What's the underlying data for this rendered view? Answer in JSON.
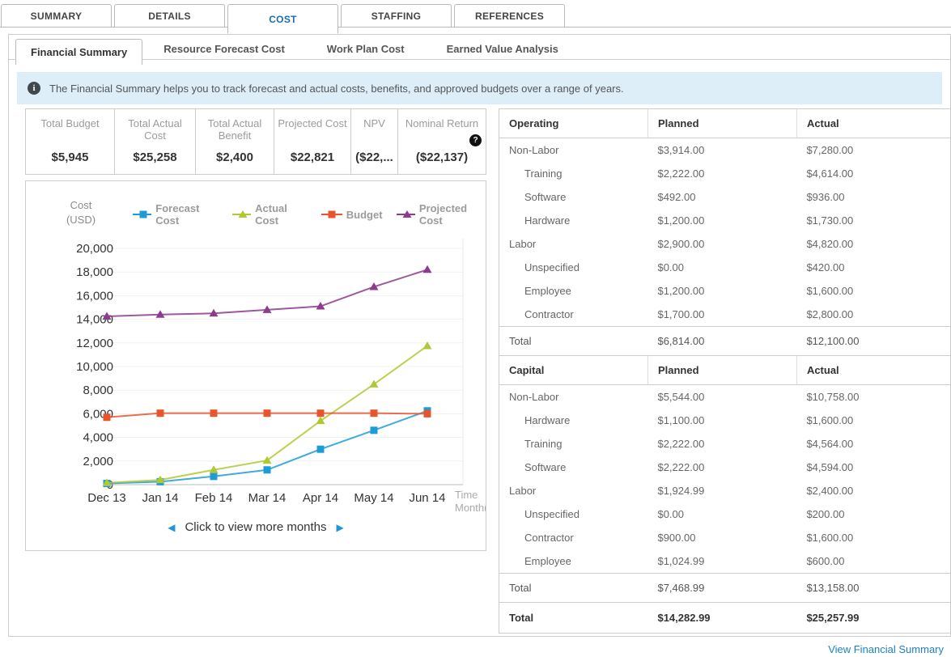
{
  "main_tabs": [
    {
      "label": "SUMMARY",
      "active": false
    },
    {
      "label": "DETAILS",
      "active": false
    },
    {
      "label": "COST",
      "active": true
    },
    {
      "label": "STAFFING",
      "active": false
    },
    {
      "label": "REFERENCES",
      "active": false
    }
  ],
  "sub_tabs": [
    {
      "label": "Financial Summary",
      "active": true
    },
    {
      "label": "Resource Forecast Cost",
      "active": false
    },
    {
      "label": "Work Plan Cost",
      "active": false
    },
    {
      "label": "Earned Value Analysis",
      "active": false
    }
  ],
  "banner": {
    "text": "The Financial Summary helps you to track forecast and actual costs, benefits, and approved budgets over a range of years."
  },
  "icons": {
    "info": "i",
    "help": "?"
  },
  "stats": [
    {
      "label": "Total Budget",
      "value": "$5,945"
    },
    {
      "label": "Total Actual Cost",
      "value": "$25,258"
    },
    {
      "label": "Total Actual Benefit",
      "value": "$2,400"
    },
    {
      "label": "Projected Cost",
      "value": "$22,821"
    },
    {
      "label": "NPV",
      "value": "($22,..."
    },
    {
      "label": "Nominal Return",
      "value": "($22,137)",
      "help_icon": true
    }
  ],
  "chart_data": {
    "type": "line",
    "title": "",
    "ylabel": "Cost (USD)",
    "xlabel": "Time Month(s)",
    "x": [
      "Dec 13",
      "Jan 14",
      "Feb 14",
      "Mar 14",
      "Apr 14",
      "May 14",
      "Jun 14"
    ],
    "series": [
      {
        "name": "Forecast Cost",
        "color": "#1e9cd8",
        "marker": "square",
        "values": [
          100,
          250,
          700,
          1250,
          3000,
          4600,
          6250
        ]
      },
      {
        "name": "Actual Cost",
        "color": "#b0c832",
        "marker": "triangle",
        "values": [
          150,
          400,
          1250,
          2050,
          5400,
          8500,
          11750
        ]
      },
      {
        "name": "Budget",
        "color": "#e8552d",
        "marker": "square",
        "values": [
          5700,
          6050,
          6050,
          6050,
          6050,
          6050,
          6000
        ]
      },
      {
        "name": "Projected Cost",
        "color": "#8e3a8e",
        "marker": "triangle",
        "values": [
          14250,
          14400,
          14500,
          14800,
          15100,
          16750,
          18200
        ]
      }
    ],
    "ylim": [
      0,
      20000
    ],
    "ytick_step": 2000,
    "grid": true,
    "legend_position": "top"
  },
  "pager": {
    "prev": "◀",
    "label": "Click to view more months",
    "next": "▶"
  },
  "financial_table": {
    "sections": [
      {
        "header": {
          "category": "Operating",
          "planned": "Planned",
          "actual": "Actual"
        },
        "rows": [
          {
            "label": "Non-Labor",
            "indent": false,
            "planned": "$3,914.00",
            "actual": "$7,280.00"
          },
          {
            "label": "Training",
            "indent": true,
            "planned": "$2,222.00",
            "actual": "$4,614.00"
          },
          {
            "label": "Software",
            "indent": true,
            "planned": "$492.00",
            "actual": "$936.00"
          },
          {
            "label": "Hardware",
            "indent": true,
            "planned": "$1,200.00",
            "actual": "$1,730.00"
          },
          {
            "label": "Labor",
            "indent": false,
            "planned": "$2,900.00",
            "actual": "$4,820.00"
          },
          {
            "label": "Unspecified",
            "indent": true,
            "planned": "$0.00",
            "actual": "$420.00"
          },
          {
            "label": "Employee",
            "indent": true,
            "planned": "$1,200.00",
            "actual": "$1,600.00"
          },
          {
            "label": "Contractor",
            "indent": true,
            "planned": "$1,700.00",
            "actual": "$2,800.00"
          }
        ],
        "total": {
          "label": "Total",
          "planned": "$6,814.00",
          "actual": "$12,100.00"
        }
      },
      {
        "header": {
          "category": "Capital",
          "planned": "Planned",
          "actual": "Actual"
        },
        "rows": [
          {
            "label": "Non-Labor",
            "indent": false,
            "planned": "$5,544.00",
            "actual": "$10,758.00"
          },
          {
            "label": "Hardware",
            "indent": true,
            "planned": "$1,100.00",
            "actual": "$1,600.00"
          },
          {
            "label": "Training",
            "indent": true,
            "planned": "$2,222.00",
            "actual": "$4,564.00"
          },
          {
            "label": "Software",
            "indent": true,
            "planned": "$2,222.00",
            "actual": "$4,594.00"
          },
          {
            "label": "Labor",
            "indent": false,
            "planned": "$1,924.99",
            "actual": "$2,400.00"
          },
          {
            "label": "Unspecified",
            "indent": true,
            "planned": "$0.00",
            "actual": "$200.00"
          },
          {
            "label": "Contractor",
            "indent": true,
            "planned": "$900.00",
            "actual": "$1,600.00"
          },
          {
            "label": "Employee",
            "indent": true,
            "planned": "$1,024.99",
            "actual": "$600.00"
          }
        ],
        "total": {
          "label": "Total",
          "planned": "$7,468.99",
          "actual": "$13,158.00"
        }
      }
    ],
    "grand_total": {
      "label": "Total",
      "planned": "$14,282.99",
      "actual": "$25,257.99"
    }
  },
  "footer": {
    "link": "View Financial Summary"
  },
  "colors": {
    "active_tab_text": "#1b6eae",
    "banner_bg": "#ddeef8",
    "link": "#1c82c7",
    "forecast_cost": "#1e9cd8",
    "actual_cost": "#b0c832",
    "budget": "#e8552d",
    "projected_cost": "#8e3a8e"
  }
}
